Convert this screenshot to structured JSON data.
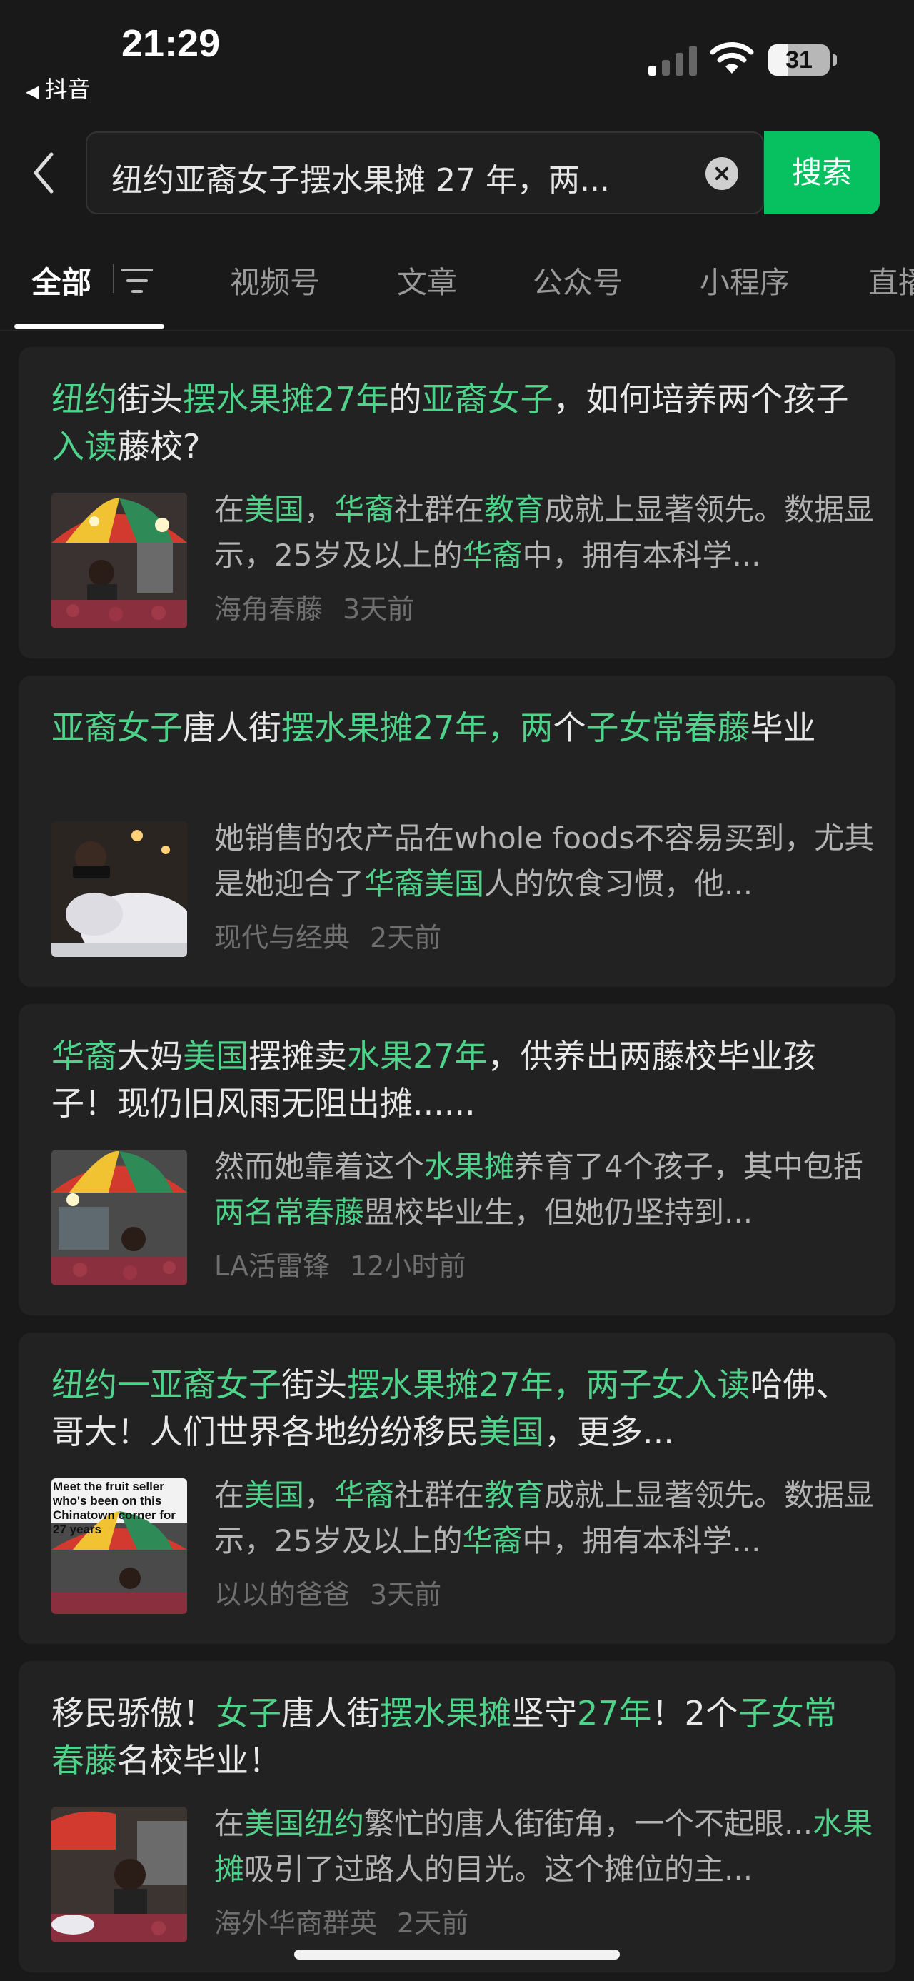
{
  "status_bar": {
    "time": "21:29",
    "back_app": "抖音",
    "battery_level": "31",
    "battery_fraction": 0.31
  },
  "search": {
    "query": "纽约亚裔女子摆水果摊 27 年，两...",
    "button": "搜索"
  },
  "tabs": [
    "全部",
    "视频号",
    "文章",
    "公众号",
    "小程序",
    "直播"
  ],
  "active_tab": "全部",
  "results": [
    {
      "title": [
        {
          "t": "纽约",
          "hl": true
        },
        {
          "t": "街头",
          "hl": false
        },
        {
          "t": "摆水果摊27年",
          "hl": true
        },
        {
          "t": "的",
          "hl": false
        },
        {
          "t": "亚裔女子",
          "hl": true
        },
        {
          "t": "，如何培养两个孩子",
          "hl": false
        },
        {
          "t": "入读",
          "hl": true
        },
        {
          "t": "藤校?",
          "hl": false
        }
      ],
      "snippet": [
        {
          "t": "在",
          "hl": false
        },
        {
          "t": "美国",
          "hl": true
        },
        {
          "t": "，",
          "hl": false
        },
        {
          "t": "华裔",
          "hl": true
        },
        {
          "t": "社群在",
          "hl": false
        },
        {
          "t": "教育",
          "hl": true
        },
        {
          "t": "成就上显著领先。数据显示，25岁及以上的",
          "hl": false
        },
        {
          "t": "华裔",
          "hl": true
        },
        {
          "t": "中，拥有本科学...",
          "hl": false
        }
      ],
      "source": "海角春藤",
      "time": "3天前",
      "thumb_caption": ""
    },
    {
      "title": [
        {
          "t": "亚裔女子",
          "hl": true
        },
        {
          "t": "唐人街",
          "hl": false
        },
        {
          "t": "摆水果摊27年，两",
          "hl": true
        },
        {
          "t": "个",
          "hl": false
        },
        {
          "t": "子女常春藤",
          "hl": true
        },
        {
          "t": "毕业",
          "hl": false
        }
      ],
      "snippet": [
        {
          "t": "她销售的农产品在whole foods不容易买到，尤其是她迎合了",
          "hl": false
        },
        {
          "t": "华裔美国",
          "hl": true
        },
        {
          "t": "人的饮食习惯，他...",
          "hl": false
        }
      ],
      "source": "现代与经典",
      "time": "2天前",
      "thumb_caption": ""
    },
    {
      "title": [
        {
          "t": "华裔",
          "hl": true
        },
        {
          "t": "大妈",
          "hl": false
        },
        {
          "t": "美国",
          "hl": true
        },
        {
          "t": "摆摊卖",
          "hl": false
        },
        {
          "t": "水果27年",
          "hl": true
        },
        {
          "t": "，供养出两藤校毕业孩子！现仍旧风雨无阻出摊......",
          "hl": false
        }
      ],
      "snippet": [
        {
          "t": "然而她靠着这个",
          "hl": false
        },
        {
          "t": "水果摊",
          "hl": true
        },
        {
          "t": "养育了4个孩子，其中包括",
          "hl": false
        },
        {
          "t": "两名常春藤",
          "hl": true
        },
        {
          "t": "盟校毕业生，但她仍坚持到...",
          "hl": false
        }
      ],
      "source": "LA活雷锋",
      "time": "12小时前",
      "thumb_caption": ""
    },
    {
      "title": [
        {
          "t": "纽约一亚裔女子",
          "hl": true
        },
        {
          "t": "街头",
          "hl": false
        },
        {
          "t": "摆水果摊27年，两子女入读",
          "hl": true
        },
        {
          "t": "哈佛、哥大！人们世界各地纷纷移民",
          "hl": false
        },
        {
          "t": "美国",
          "hl": true
        },
        {
          "t": "，更多...",
          "hl": false
        }
      ],
      "snippet": [
        {
          "t": "在",
          "hl": false
        },
        {
          "t": "美国",
          "hl": true
        },
        {
          "t": "，",
          "hl": false
        },
        {
          "t": "华裔",
          "hl": true
        },
        {
          "t": "社群在",
          "hl": false
        },
        {
          "t": "教育",
          "hl": true
        },
        {
          "t": "成就上显著领先。数据显示，25岁及以上的",
          "hl": false
        },
        {
          "t": "华裔",
          "hl": true
        },
        {
          "t": "中，拥有本科学...",
          "hl": false
        }
      ],
      "source": "以以的爸爸",
      "time": "3天前",
      "thumb_caption": "Meet the fruit seller who's been on this Chinatown corner for 27 years"
    },
    {
      "title": [
        {
          "t": "移民骄傲！",
          "hl": false
        },
        {
          "t": "女子",
          "hl": true
        },
        {
          "t": "唐人街",
          "hl": false
        },
        {
          "t": "摆水果摊",
          "hl": true
        },
        {
          "t": "坚守",
          "hl": false
        },
        {
          "t": "27年",
          "hl": true
        },
        {
          "t": "！2个",
          "hl": false
        },
        {
          "t": "子女常春藤",
          "hl": true
        },
        {
          "t": "名校毕业！",
          "hl": false
        }
      ],
      "snippet": [
        {
          "t": "在",
          "hl": false
        },
        {
          "t": "美国纽约",
          "hl": true
        },
        {
          "t": "繁忙的唐人街街角，一个不起眼...",
          "hl": false
        },
        {
          "t": "水果摊",
          "hl": true
        },
        {
          "t": "吸引了过路人的目光。这个摊位的主...",
          "hl": false
        }
      ],
      "source": "海外华商群英",
      "time": "2天前",
      "thumb_caption": ""
    }
  ],
  "colors": {
    "accent": "#07c160",
    "highlight": "#4fd38a",
    "background": "#191919",
    "card": "#222222"
  },
  "icons": [
    "back-chevron-icon",
    "signal-icon",
    "wifi-icon",
    "battery-icon",
    "clear-icon",
    "filter-icon"
  ]
}
